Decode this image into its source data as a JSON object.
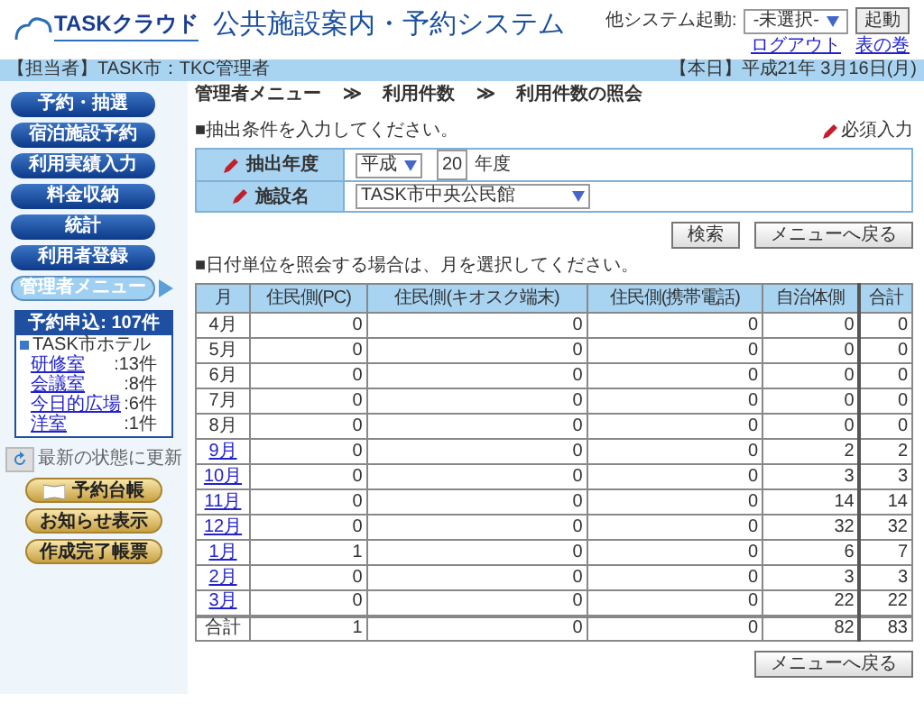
{
  "header": {
    "logo": "TASKクラウド",
    "title": "公共施設案内・予約システム",
    "launcher_label": "他システム起動:",
    "launcher_select": "-未選択-",
    "launch_button": "起動",
    "links": [
      "ログアウト",
      "表の巻"
    ]
  },
  "user_bar": {
    "user": "【担当者】TASK市：TKC管理者",
    "date": "【本日】平成21年 3月16日(月)"
  },
  "breadcrumb": [
    {
      "text": "管理者メニュー"
    },
    {
      "separator": "≫",
      "text": "利用件数"
    },
    {
      "separator": "≫",
      "text": "利用件数の照会"
    }
  ],
  "sidebar": {
    "menu": [
      {
        "label": "予約・抽選",
        "selected": false
      },
      {
        "label": "宿泊施設予約",
        "selected": false
      },
      {
        "label": "利用実績入力",
        "selected": false
      },
      {
        "label": "料金収納",
        "selected": false
      },
      {
        "label": "統計",
        "selected": false
      },
      {
        "label": "利用者登録",
        "selected": false
      },
      {
        "label": "管理者メニュー",
        "selected": true
      }
    ],
    "requests": {
      "title": "予約申込: 107件",
      "facility": "TASK市ホテル",
      "items": [
        {
          "name": "研修室",
          "count": ":13件"
        },
        {
          "name": "会議室",
          "count": ":8件"
        },
        {
          "name": "今日的広場",
          "count": ":6件"
        },
        {
          "name": "洋室",
          "count": ":1件"
        }
      ]
    },
    "refresh": "最新の状態に更新",
    "gold_buttons": [
      {
        "label": "予約台帳",
        "kind": "book"
      },
      {
        "label": "お知らせ表示",
        "kind": "plain"
      },
      {
        "label": "作成完了帳票",
        "kind": "plain"
      }
    ]
  },
  "form": {
    "instruction": "■抽出条件を入力してください。",
    "required_legend": "必須入力",
    "fields": [
      {
        "label": "抽出年度",
        "era": "平成",
        "year": "20",
        "suffix": "年度"
      },
      {
        "label": "施設名",
        "facility": "TASK市中央公民館"
      }
    ],
    "buttons": [
      "検索",
      "メニューへ戻る"
    ]
  },
  "table": {
    "instruction": "■日付単位を照会する場合は、月を選択してください。",
    "columns": [
      "月",
      "住民側(PC)",
      "住民側(キオスク端末)",
      "住民側(携帯電話)",
      "自治体側",
      "合計"
    ],
    "rows": [
      {
        "month": "4月",
        "link": false,
        "values": [
          "0",
          "0",
          "0",
          "0",
          "0"
        ]
      },
      {
        "month": "5月",
        "link": false,
        "values": [
          "0",
          "0",
          "0",
          "0",
          "0"
        ]
      },
      {
        "month": "6月",
        "link": false,
        "values": [
          "0",
          "0",
          "0",
          "0",
          "0"
        ]
      },
      {
        "month": "7月",
        "link": false,
        "values": [
          "0",
          "0",
          "0",
          "0",
          "0"
        ]
      },
      {
        "month": "8月",
        "link": false,
        "values": [
          "0",
          "0",
          "0",
          "0",
          "0"
        ]
      },
      {
        "month": "9月",
        "link": true,
        "values": [
          "0",
          "0",
          "0",
          "2",
          "2"
        ]
      },
      {
        "month": "10月",
        "link": true,
        "values": [
          "0",
          "0",
          "0",
          "3",
          "3"
        ]
      },
      {
        "month": "11月",
        "link": true,
        "values": [
          "0",
          "0",
          "0",
          "14",
          "14"
        ]
      },
      {
        "month": "12月",
        "link": true,
        "values": [
          "0",
          "0",
          "0",
          "32",
          "32"
        ]
      },
      {
        "month": "1月",
        "link": true,
        "values": [
          "1",
          "0",
          "0",
          "6",
          "7"
        ]
      },
      {
        "month": "2月",
        "link": true,
        "values": [
          "0",
          "0",
          "0",
          "3",
          "3"
        ]
      },
      {
        "month": "3月",
        "link": true,
        "values": [
          "0",
          "0",
          "0",
          "22",
          "22"
        ]
      }
    ],
    "total": {
      "label": "合計",
      "values": [
        "1",
        "0",
        "0",
        "82",
        "83"
      ]
    }
  },
  "bottom_button": "メニューへ戻る"
}
